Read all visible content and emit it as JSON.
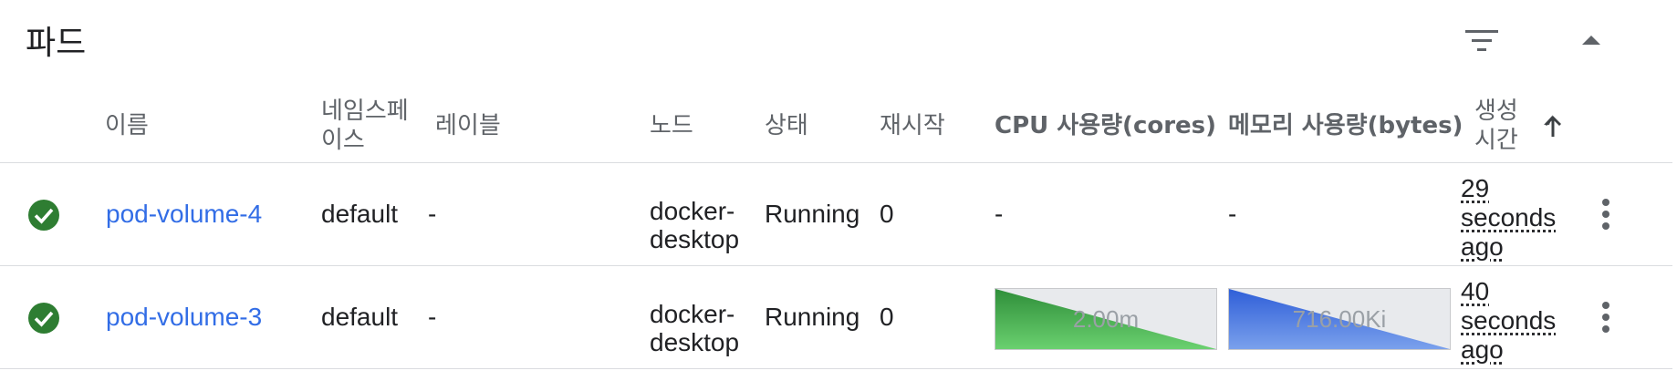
{
  "header": {
    "title": "파드",
    "filter_icon": "filter-icon",
    "collapse_icon": "chevron-up-icon"
  },
  "columns": {
    "name": "이름",
    "namespace_line1": "네임스페",
    "namespace_line2": "이스",
    "labels": "레이블",
    "node": "노드",
    "status": "상태",
    "restarts": "재시작",
    "cpu": "CPU 사용량(cores)",
    "memory": "메모리 사용량(bytes)",
    "created_line1": "생성",
    "created_line2": "시간",
    "sort_icon": "arrow-up-icon"
  },
  "rows": [
    {
      "status_icon": "check-circle-icon",
      "name": "pod-volume-4",
      "namespace": "default",
      "labels": "-",
      "node_line1": "docker-",
      "node_line2": "desktop",
      "status": "Running",
      "restarts": "0",
      "cpu": "-",
      "memory": "-",
      "age_line1": "29",
      "age_line2": "seconds",
      "age_line3": "ago",
      "menu_icon": "more-vertical-icon"
    },
    {
      "status_icon": "check-circle-icon",
      "name": "pod-volume-3",
      "namespace": "default",
      "labels": "-",
      "node_line1": "docker-",
      "node_line2": "desktop",
      "status": "Running",
      "restarts": "0",
      "cpu": "2.00m",
      "memory": "716.00Ki",
      "age_line1": "40",
      "age_line2": "seconds",
      "age_line3": "ago",
      "menu_icon": "more-vertical-icon"
    }
  ],
  "colors": {
    "link": "#326de6",
    "success": "#2e7d32",
    "cpu_spark": "#4caf50",
    "memory_spark": "#3f6fe0"
  }
}
